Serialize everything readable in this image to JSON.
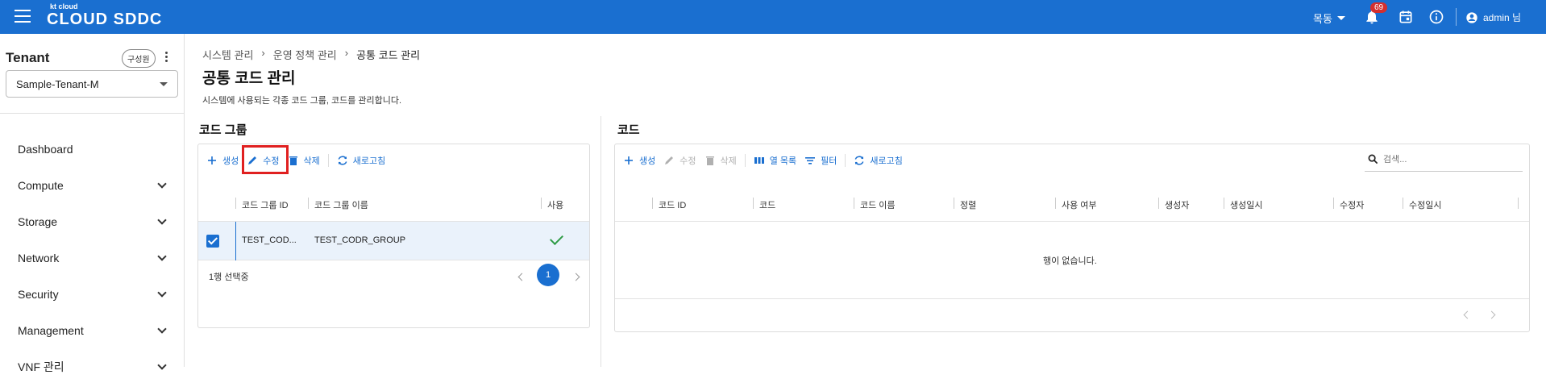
{
  "header": {
    "logo_small": "kt cloud",
    "logo_big": "CLOUD SDDC",
    "site": "목동",
    "notification_count": "69",
    "user": "admin 님"
  },
  "sidebar": {
    "title": "Tenant",
    "members_label": "구성원",
    "tenant_value": "Sample-Tenant-M",
    "items": [
      {
        "label": "Dashboard"
      },
      {
        "label": "Compute"
      },
      {
        "label": "Storage"
      },
      {
        "label": "Network"
      },
      {
        "label": "Security"
      },
      {
        "label": "Management"
      },
      {
        "label": "VNF 관리"
      }
    ]
  },
  "breadcrumb": [
    "시스템 관리",
    "운영 정책 관리",
    "공통 코드 관리"
  ],
  "page": {
    "title": "공통 코드 관리",
    "description": "시스템에 사용되는 각종 코드 그룹, 코드를 관리합니다."
  },
  "code_group": {
    "title": "코드 그룹",
    "toolbar": {
      "create": "생성",
      "edit": "수정",
      "delete": "삭제",
      "refresh": "새로고침"
    },
    "columns": [
      "코드 그룹 ID",
      "코드 그룹 이름",
      "사용"
    ],
    "rows": [
      {
        "id": "TEST_COD...",
        "name": "TEST_CODR_GROUP",
        "used": true
      }
    ],
    "selected_text": "1행 선택중",
    "page": "1"
  },
  "code": {
    "title": "코드",
    "toolbar": {
      "create": "생성",
      "edit": "수정",
      "delete": "삭제",
      "columns": "열 목록",
      "filter": "필터",
      "refresh": "새로고침"
    },
    "search_placeholder": "검색...",
    "columns": [
      "코드 ID",
      "코드",
      "코드 이름",
      "정렬",
      "사용 여부",
      "생성자",
      "생성일시",
      "수정자",
      "수정일시"
    ],
    "empty_message": "행이 없습니다."
  },
  "colors": {
    "primary": "#1a6fd0",
    "highlight": "#e02020",
    "success": "#2e9b45",
    "badge": "#d32f2f"
  }
}
